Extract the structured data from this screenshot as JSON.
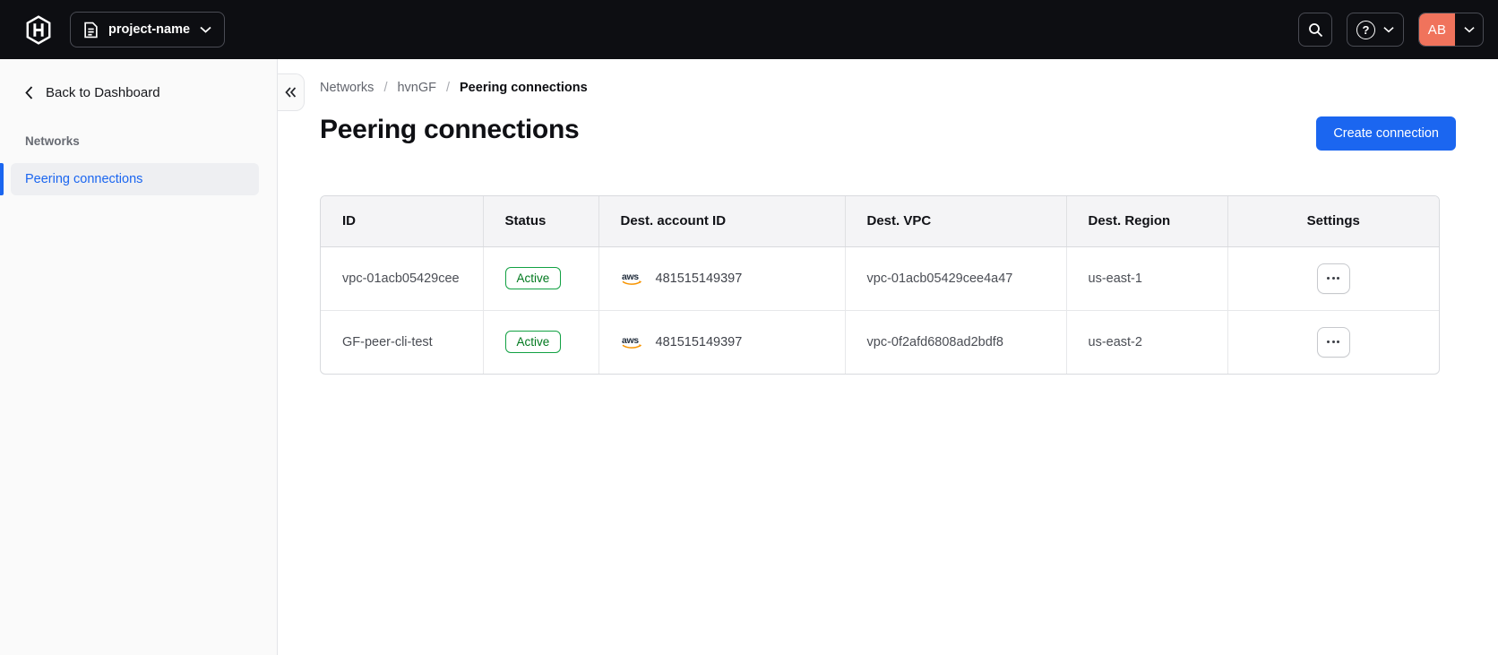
{
  "topbar": {
    "project_selector_label": "project-name",
    "avatar_initials": "AB"
  },
  "sidebar": {
    "back_label": "Back to Dashboard",
    "section_title": "Networks",
    "items": [
      {
        "label": "Peering connections",
        "active": true
      }
    ]
  },
  "breadcrumb": {
    "items": [
      "Networks",
      "hvnGF",
      "Peering connections"
    ],
    "separator": "/"
  },
  "page": {
    "title": "Peering connections",
    "create_button_label": "Create connection"
  },
  "table": {
    "columns": [
      "ID",
      "Status",
      "Dest. account ID",
      "Dest. VPC",
      "Dest. Region",
      "Settings"
    ],
    "rows": [
      {
        "id": "vpc-01acb05429cee",
        "status": "Active",
        "dest_account_provider": "aws",
        "dest_account_id": "481515149397",
        "dest_vpc": "vpc-01acb05429cee4a47",
        "dest_region": "us-east-1"
      },
      {
        "id": "GF-peer-cli-test",
        "status": "Active",
        "dest_account_provider": "aws",
        "dest_account_id": "481515149397",
        "dest_vpc": "vpc-0f2afd6808ad2bdf8",
        "dest_region": "us-east-2"
      }
    ]
  },
  "icons": {
    "hashicorp-logo": "H in hexagon outline",
    "document-icon": "file/page outline",
    "chevron-down-icon": "v",
    "search-icon": "magnifying glass",
    "help-icon": "? in circle",
    "chevron-left-icon": "<",
    "collapse-sidebar-icon": "«",
    "aws-logo-icon": "aws with orange smile",
    "ellipsis-icon": "•••"
  },
  "colors": {
    "topbar_bg": "#0d0e12",
    "accent_blue": "#1b66f0",
    "avatar_orange": "#f0735c",
    "badge_green_border": "#12a143",
    "badge_green_text": "#00781e",
    "aws_orange": "#f79400"
  }
}
